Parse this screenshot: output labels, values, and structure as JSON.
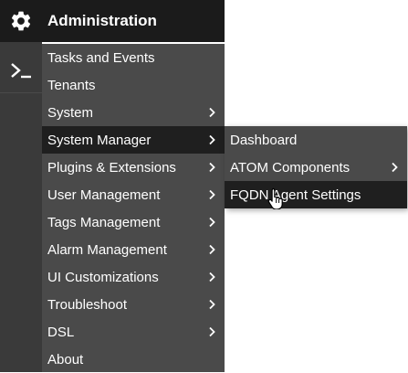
{
  "header": {
    "title": "Administration",
    "gear_icon": "gear-icon"
  },
  "rail": {
    "terminal_icon": "terminal-icon"
  },
  "menu": {
    "items": [
      {
        "label": "Tasks and Events",
        "has_submenu": false
      },
      {
        "label": "Tenants",
        "has_submenu": false
      },
      {
        "label": "System",
        "has_submenu": true
      },
      {
        "label": "System Manager",
        "has_submenu": true,
        "active": true
      },
      {
        "label": "Plugins & Extensions",
        "has_submenu": true
      },
      {
        "label": "User Management",
        "has_submenu": true
      },
      {
        "label": "Tags Management",
        "has_submenu": true
      },
      {
        "label": "Alarm Management",
        "has_submenu": true
      },
      {
        "label": "UI Customizations",
        "has_submenu": true
      },
      {
        "label": "Troubleshoot",
        "has_submenu": true
      },
      {
        "label": "DSL",
        "has_submenu": true
      },
      {
        "label": "About",
        "has_submenu": false
      }
    ]
  },
  "submenu": {
    "items": [
      {
        "label": "Dashboard",
        "has_submenu": false
      },
      {
        "label": "ATOM Components",
        "has_submenu": true
      },
      {
        "label": "FQDN Agent Settings",
        "has_submenu": false,
        "hovered": true
      }
    ]
  },
  "colors": {
    "header_bg": "#1b1b1b",
    "menu_bg": "#4a4a4a",
    "active_bg": "#1f1f1f",
    "text": "#ffffff"
  }
}
